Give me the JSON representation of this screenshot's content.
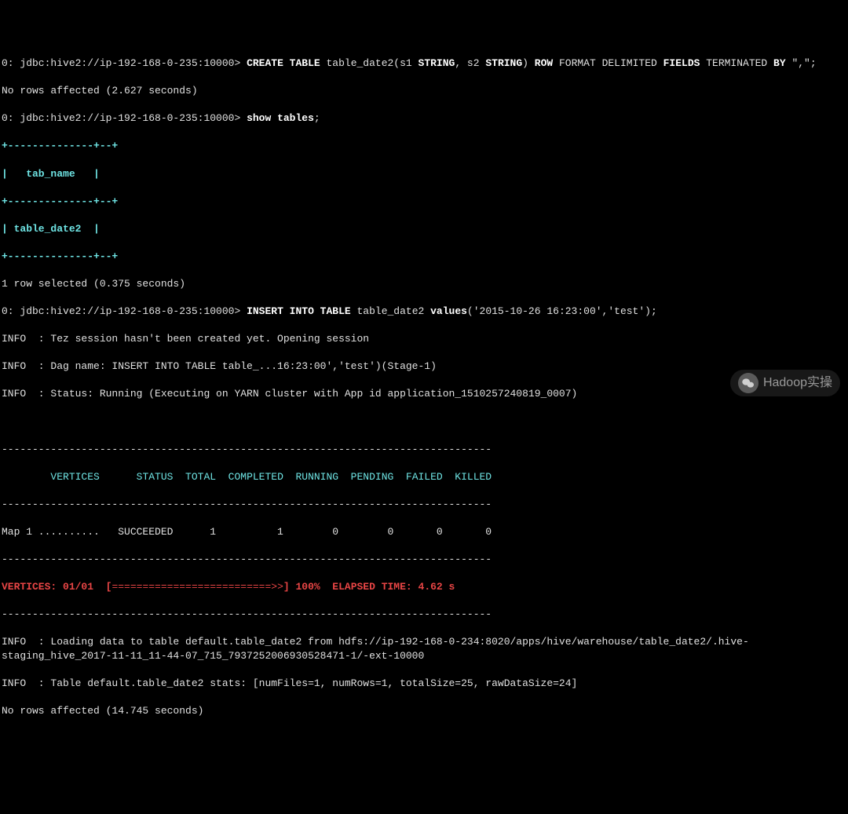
{
  "prompt": "0: jdbc:hive2://ip-192-168-0-235:10000>",
  "cmd1_a": "CREATE TABLE",
  "cmd1_b": " table_date2(s1 ",
  "cmd1_c": "STRING",
  "cmd1_d": ", s2 ",
  "cmd1_e": "STRING",
  "cmd1_f": ") ",
  "cmd1_g": "ROW",
  "cmd1_h": " FORMAT DELIMITED ",
  "cmd1_i": "FIELDS",
  "cmd1_j": " TERMINATED ",
  "cmd1_k": "BY",
  "cmd1_l": " \",\";",
  "result1": "No rows affected (2.627 seconds)",
  "cmd2": "show tables",
  "table_border": "+--------------+--+",
  "table_header": "|   tab_name   |",
  "table_row": "| table_date2  |",
  "result2": "1 row selected (0.375 seconds)",
  "cmd3_a": "INSERT INTO TABLE",
  "cmd3_b": " table_date2 ",
  "cmd3_c": "values",
  "cmd3_d": "('2015-10-26 16:23:00','test');",
  "info1": "INFO  : Tez session hasn't been created yet. Opening session",
  "info2": "INFO  : Dag name: INSERT INTO TABLE table_...16:23:00','test')(Stage-1)",
  "info3": "INFO  : Status: Running (Executing on YARN cluster with App id application_1510257240819_0007)",
  "dashline": "--------------------------------------------------------------------------------",
  "stats_header": "        VERTICES      STATUS  TOTAL  COMPLETED  RUNNING  PENDING  FAILED  KILLED",
  "stats_row": "Map 1 ..........   SUCCEEDED      1          1        0        0       0       0",
  "progress_a": "VERTICES: 01/01  [",
  "progress_b": "==========================>>",
  "progress_c": "] 100%  ",
  "progress_d": "ELAPSED TIME: 4.62 s",
  "info4": "INFO  : Loading data to table default.table_date2 from hdfs://ip-192-168-0-234:8020/apps/hive/warehouse/table_date2/.hive-staging_hive_2017-11-11_11-44-07_715_7937252006930528471-1/-ext-10000",
  "info5": "INFO  : Table default.table_date2 stats: [numFiles=1, numRows=1, totalSize=25, rawDataSize=24]",
  "result3": "No rows affected (14.745 seconds)",
  "watermark_text": "Hadoop实操",
  "chart_data": {
    "type": "table",
    "title": "Tez Execution Progress",
    "columns": [
      "VERTICES",
      "STATUS",
      "TOTAL",
      "COMPLETED",
      "RUNNING",
      "PENDING",
      "FAILED",
      "KILLED"
    ],
    "rows": [
      [
        "Map 1",
        "SUCCEEDED",
        1,
        1,
        0,
        0,
        0,
        0
      ]
    ],
    "progress_percent": 100,
    "elapsed_seconds": 4.62,
    "vertices_done": "01/01"
  }
}
